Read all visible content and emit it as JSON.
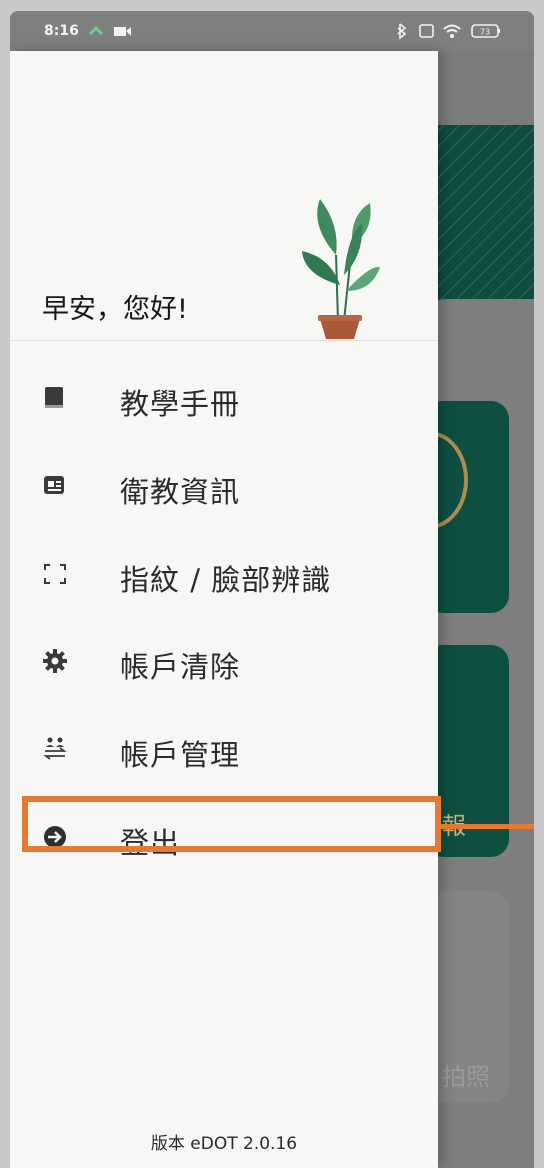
{
  "status_bar": {
    "time": "8:16",
    "battery": "73"
  },
  "drawer": {
    "greeting": "早安，您好!",
    "menu": [
      {
        "label": "教學手冊",
        "icon": "book-icon"
      },
      {
        "label": "衛教資訊",
        "icon": "newspaper-icon"
      },
      {
        "label": "指紋 / 臉部辨識",
        "icon": "scan-frame-icon"
      },
      {
        "label": "帳戶清除",
        "icon": "gear-icon"
      },
      {
        "label": "帳戶管理",
        "icon": "people-swap-icon"
      },
      {
        "label": "登出",
        "icon": "logout-arrow-icon"
      }
    ],
    "version": "版本 eDOT 2.0.16"
  },
  "background_app": {
    "partial_label_1": "報",
    "partial_label_2": "拍照"
  },
  "colors": {
    "highlight": "#e6782f",
    "brand_dark_green": "#0e4f41"
  }
}
